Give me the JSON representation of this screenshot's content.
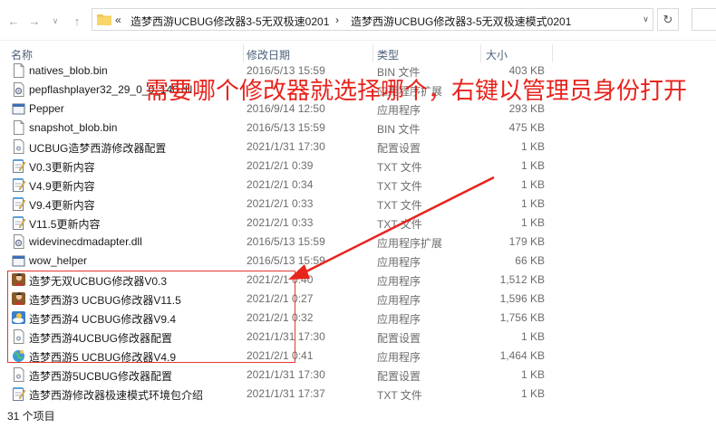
{
  "address": {
    "chevrons": "«",
    "crumbs": [
      "造梦西游UCBUG修改器3-5无双极速0201",
      "造梦西游UCBUG修改器3-5无双极速模式0201"
    ]
  },
  "columns": {
    "name": "名称",
    "date": "修改日期",
    "type": "类型",
    "size": "大小"
  },
  "files": [
    {
      "name": "natives_blob.bin",
      "date": "2016/5/13 15:59",
      "type": "BIN 文件",
      "size": "403 KB",
      "icon": "blank-file-icon"
    },
    {
      "name": "pepflashplayer32_29_0_0_140.dll",
      "date": "",
      "type": "应用程序扩展",
      "size": "",
      "icon": "dll-file-icon"
    },
    {
      "name": "Pepper",
      "date": "2016/9/14 12:50",
      "type": "应用程序",
      "size": "293 KB",
      "icon": "app-window-icon"
    },
    {
      "name": "snapshot_blob.bin",
      "date": "2016/5/13 15:59",
      "type": "BIN 文件",
      "size": "475 KB",
      "icon": "blank-file-icon"
    },
    {
      "name": "UCBUG造梦西游修改器配置",
      "date": "2021/1/31 17:30",
      "type": "配置设置",
      "size": "1 KB",
      "icon": "config-file-icon"
    },
    {
      "name": "V0.3更新内容",
      "date": "2021/2/1 0:39",
      "type": "TXT 文件",
      "size": "1 KB",
      "icon": "notepad-icon"
    },
    {
      "name": "V4.9更新内容",
      "date": "2021/2/1 0:34",
      "type": "TXT 文件",
      "size": "1 KB",
      "icon": "notepad-icon"
    },
    {
      "name": "V9.4更新内容",
      "date": "2021/2/1 0:33",
      "type": "TXT 文件",
      "size": "1 KB",
      "icon": "notepad-icon"
    },
    {
      "name": "V11.5更新内容",
      "date": "2021/2/1 0:33",
      "type": "TXT 文件",
      "size": "1 KB",
      "icon": "notepad-icon"
    },
    {
      "name": "widevinecdmadapter.dll",
      "date": "2016/5/13 15:59",
      "type": "应用程序扩展",
      "size": "179 KB",
      "icon": "dll-file-icon"
    },
    {
      "name": "wow_helper",
      "date": "2016/5/13 15:59",
      "type": "应用程序",
      "size": "66 KB",
      "icon": "app-window-icon"
    },
    {
      "name": "造梦无双UCBUG修改器V0.3",
      "date": "2021/2/1 0:40",
      "type": "应用程序",
      "size": "1,512 KB",
      "icon": "game-character-icon"
    },
    {
      "name": "造梦西游3 UCBUG修改器V11.5",
      "date": "2021/2/1 0:27",
      "type": "应用程序",
      "size": "1,596 KB",
      "icon": "game-character-icon"
    },
    {
      "name": "造梦西游4 UCBUG修改器V9.4",
      "date": "2021/2/1 0:32",
      "type": "应用程序",
      "size": "1,756 KB",
      "icon": "game-cloud-icon"
    },
    {
      "name": "造梦西游4UCBUG修改器配置",
      "date": "2021/1/31 17:30",
      "type": "配置设置",
      "size": "1 KB",
      "icon": "config-file-icon"
    },
    {
      "name": "造梦西游5 UCBUG修改器V4.9",
      "date": "2021/2/1 0:41",
      "type": "应用程序",
      "size": "1,464 KB",
      "icon": "game-globe-icon"
    },
    {
      "name": "造梦西游5UCBUG修改器配置",
      "date": "2021/1/31 17:30",
      "type": "配置设置",
      "size": "1 KB",
      "icon": "config-file-icon"
    },
    {
      "name": "造梦西游修改器极速模式环境包介绍",
      "date": "2021/1/31 17:37",
      "type": "TXT 文件",
      "size": "1 KB",
      "icon": "notepad-icon"
    }
  ],
  "annotation": {
    "text": "需要哪个修改器就选择哪个，右键以管理员身份打开",
    "color": "#e8231c"
  },
  "status": {
    "count": "31 个项目"
  }
}
